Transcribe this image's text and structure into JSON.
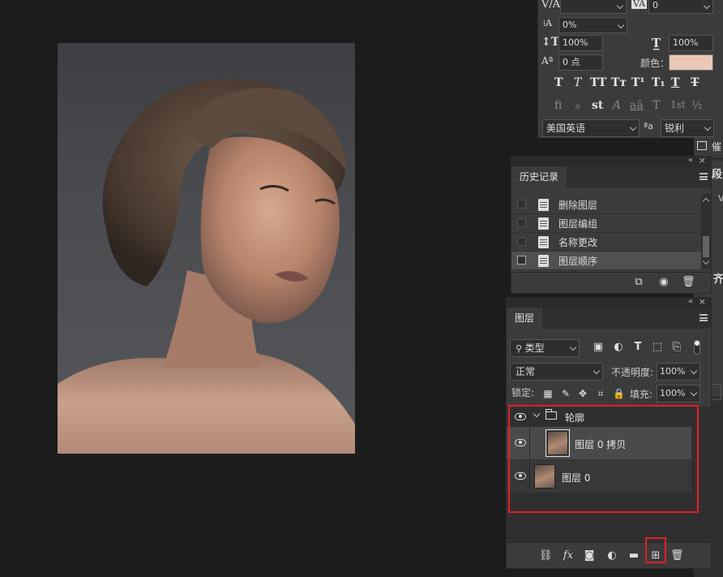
{
  "character_panel": {
    "tracking_value": "",
    "kerning_value": "0",
    "scale_label": "0%",
    "vertical_scale": "100%",
    "horizontal_scale": "100%",
    "baseline_shift": "0 点",
    "color_label": "颜色：",
    "color_value": "#eac7b6",
    "style_glyphs": [
      "T",
      "T",
      "TT",
      "Tт",
      "T¹",
      "T₁",
      "T",
      "T"
    ],
    "opentype_glyphs": [
      "fi",
      "ℴ",
      "st",
      "A",
      "aā",
      "T",
      "1st",
      "½"
    ],
    "language": "美国英语",
    "aa_label": "ªa",
    "antialias": "锐利"
  },
  "history_panel": {
    "tab_label": "历史记录",
    "items": [
      {
        "label": "删除图层",
        "selected": false
      },
      {
        "label": "图层编组",
        "selected": false
      },
      {
        "label": "名称更改",
        "selected": false
      },
      {
        "label": "图层顺序",
        "selected": true
      }
    ]
  },
  "layers_panel": {
    "tab_label": "图层",
    "filter_kind": "类型",
    "blend_mode": "正常",
    "opacity_label": "不透明度:",
    "opacity_value": "100%",
    "lock_label": "锁定:",
    "fill_label": "填充:",
    "fill_value": "100%",
    "layers": [
      {
        "name": "轮廓",
        "type": "group"
      },
      {
        "name": "图层 0 拷贝",
        "type": "layer",
        "selected": true
      },
      {
        "name": "图层 0",
        "type": "layer",
        "selected": false
      }
    ]
  },
  "strip_glyphs": [
    "催",
    "段",
    "V",
    "齐"
  ],
  "highlight_color": "#e0202a"
}
